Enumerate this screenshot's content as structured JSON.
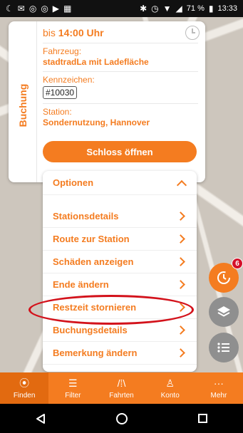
{
  "statusbar": {
    "battery": "71 %",
    "time": "13:33"
  },
  "booking": {
    "tab_label": "Buchung",
    "until_prefix": "bis",
    "until_time": "14:00 Uhr",
    "vehicle_label": "Fahrzeug:",
    "vehicle_value": "stadtradLa mit Ladefläche",
    "plate_label": "Kennzeichen:",
    "plate_value": "#10030",
    "station_label": "Station:",
    "station_value": "Sondernutzung, Hannover",
    "unlock_button": "Schloss öffnen"
  },
  "options": {
    "title": "Optionen",
    "items": [
      "Stationsdetails",
      "Route zur Station",
      "Schäden anzeigen",
      "Ende ändern",
      "Restzeit stornieren",
      "Buchungsdetails",
      "Bemerkung ändern"
    ]
  },
  "fab": {
    "badge_count": "6"
  },
  "bottom_nav": {
    "items": [
      {
        "label": "Finden",
        "icon": "pin-icon"
      },
      {
        "label": "Filter",
        "icon": "filter-icon"
      },
      {
        "label": "Fahrten",
        "icon": "road-icon"
      },
      {
        "label": "Konto",
        "icon": "person-icon"
      },
      {
        "label": "Mehr",
        "icon": "more-icon"
      }
    ]
  },
  "colors": {
    "accent": "#f47c20",
    "highlight": "#d3121b"
  }
}
